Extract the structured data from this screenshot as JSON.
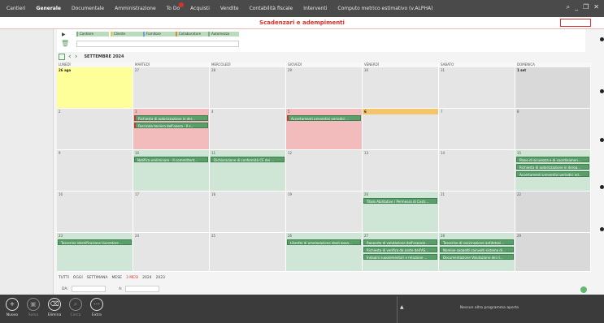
{
  "topnav": {
    "items": [
      "Cantieri",
      "Generale",
      "Documentale",
      "Amministrazione",
      "To Do",
      "Acquisti",
      "Vendite",
      "Contabilità fiscale",
      "Interventi",
      "Computo metrico estimativo (v.ALPHA)"
    ],
    "active_index": 1,
    "badge_index": 4
  },
  "window": {
    "title": "Scadenzari e adempimenti"
  },
  "filters": {
    "chips": [
      {
        "label": "Cantiere",
        "color": "#7cb27f"
      },
      {
        "label": "Cliente",
        "color": "#e3c34a"
      },
      {
        "label": "Fornitore",
        "color": "#6aa5d8"
      },
      {
        "label": "Collaboratore",
        "color": "#e5843c"
      },
      {
        "label": "Automezzo",
        "color": "#7cb27f"
      }
    ]
  },
  "calendar": {
    "month_label": "SETTEMBRE 2024",
    "weekdays": [
      "LUNEDÌ",
      "MARTEDÌ",
      "MERCOLEDÌ",
      "GIOVEDÌ",
      "VENERDÌ",
      "SABATO",
      "DOMENICA"
    ],
    "weeks": [
      [
        "26 ago",
        "27",
        "28",
        "29",
        "30",
        "31",
        "1 set"
      ],
      [
        "2",
        "3",
        "4",
        "5",
        "6",
        "7",
        "8"
      ],
      [
        "9",
        "10",
        "11",
        "12",
        "13",
        "14",
        "15"
      ],
      [
        "16",
        "17",
        "18",
        "19",
        "20",
        "21",
        "22"
      ],
      [
        "23",
        "24",
        "25",
        "26",
        "27",
        "28",
        "29"
      ]
    ],
    "events": {
      "w1d1_a": "Richiesta di autorizzazione in der...",
      "w1d1_b": "Fascicolo tecnico dell'opera - II s...",
      "w1d3_a": "Accertamenti preventivi periodici ...",
      "w2d1_a": "Notifica preliminare - II committent...",
      "w2d2_a": "Dichiarazione di conformità CE dei ...",
      "w2d6_a": "Piano di sicurezza e di coordinamen...",
      "w2d6_b": "Richiesta di autorizzazione in derog...",
      "w2d6_c": "Accertamenti preventivi periodici ed...",
      "w3d4_a": "Titolo Abilitativo ( Permesso di Costr...",
      "w4d0_a": "Tesserino identificazione lavoratore ...",
      "w4d3_a": "Libretto di omologazione degli appa...",
      "w4d4_a": "Rapporto di valutazione dell'esposiz...",
      "w4d4_b": "Richiesta di verifica da parte dell'AS...",
      "w4d4_c": "Indagini supplementari e relazione ...",
      "w4d5_a": "Tesserino di vaccinazione antitetani...",
      "w4d5_b": "Nomine soggetti coinvolti sistema di...",
      "w4d5_c": "Documentazione Valutazione dei ri..."
    }
  },
  "viewbar": {
    "items": [
      "TUTTI",
      "OGGI",
      "SETTIMANA",
      "MESE",
      "3 MESI",
      "2024",
      "2023"
    ],
    "selected_index": 4,
    "da_label": "DA:",
    "a_label": "A:"
  },
  "actions": [
    {
      "label": "Nuovo",
      "icon": "plus-icon",
      "enabled": true
    },
    {
      "label": "Salva",
      "icon": "save-icon",
      "enabled": false
    },
    {
      "label": "Elimina",
      "icon": "trash-icon",
      "enabled": true
    },
    {
      "label": "Cerca",
      "icon": "search-icon",
      "enabled": false
    },
    {
      "label": "Extra",
      "icon": "extra-icon",
      "enabled": true
    }
  ],
  "status": {
    "programs_text": "Nessun altro programma aperto"
  },
  "colors": {
    "accent": "#d9322b",
    "event_green": "#5a9e6a",
    "today_yellow": "#ffff99",
    "today_orange": "#f4c46a",
    "overdue_pink": "#f2bcbc",
    "week_green": "#cfe5d5"
  }
}
